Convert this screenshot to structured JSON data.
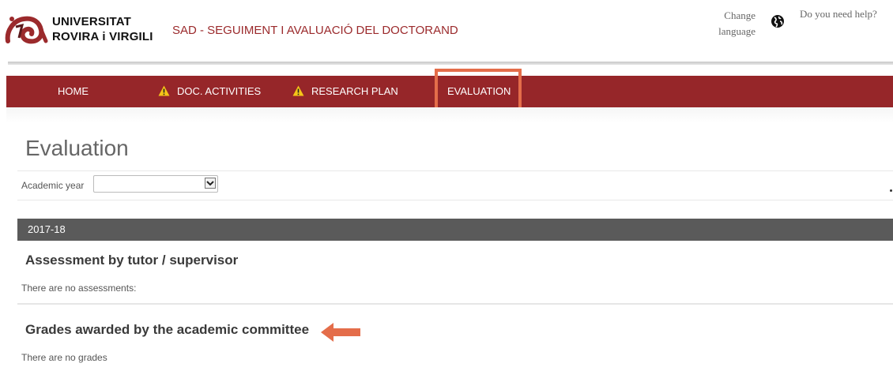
{
  "header": {
    "university_line1": "UNIVERSITAT",
    "university_line2": "ROVIRA i VIRGILI",
    "app_title": "SAD - SEGUIMENT I AVALUACIÓ DEL DOCTORAND",
    "change_language_line1": "Change",
    "change_language_line2": "language",
    "help": "Do you need help?"
  },
  "nav": {
    "items": [
      {
        "label": "HOME",
        "warning": false
      },
      {
        "label": "DOC. ACTIVITIES",
        "warning": true
      },
      {
        "label": "RESEARCH PLAN",
        "warning": true
      },
      {
        "label": "EVALUATION",
        "warning": false,
        "highlighted": true
      }
    ]
  },
  "page": {
    "title": "Evaluation",
    "filter": {
      "label": "Academic year",
      "selected": ""
    },
    "year_header": "2017-18",
    "sections": [
      {
        "title": "Assessment by tutor / supervisor",
        "note": "There are no assessments:"
      },
      {
        "title": "Grades awarded by the academic committee",
        "note": "There are no grades"
      }
    ]
  },
  "colors": {
    "brand_red": "#962629",
    "title_red": "#9b2a2c",
    "annotation_orange": "#e46d4a",
    "year_bar": "#5a5a5a",
    "warning_yellow": "#f5c518"
  },
  "icons": [
    "urv-logo",
    "globe-icon",
    "warning-icon",
    "arrow-left-icon",
    "chevron-down-icon"
  ]
}
